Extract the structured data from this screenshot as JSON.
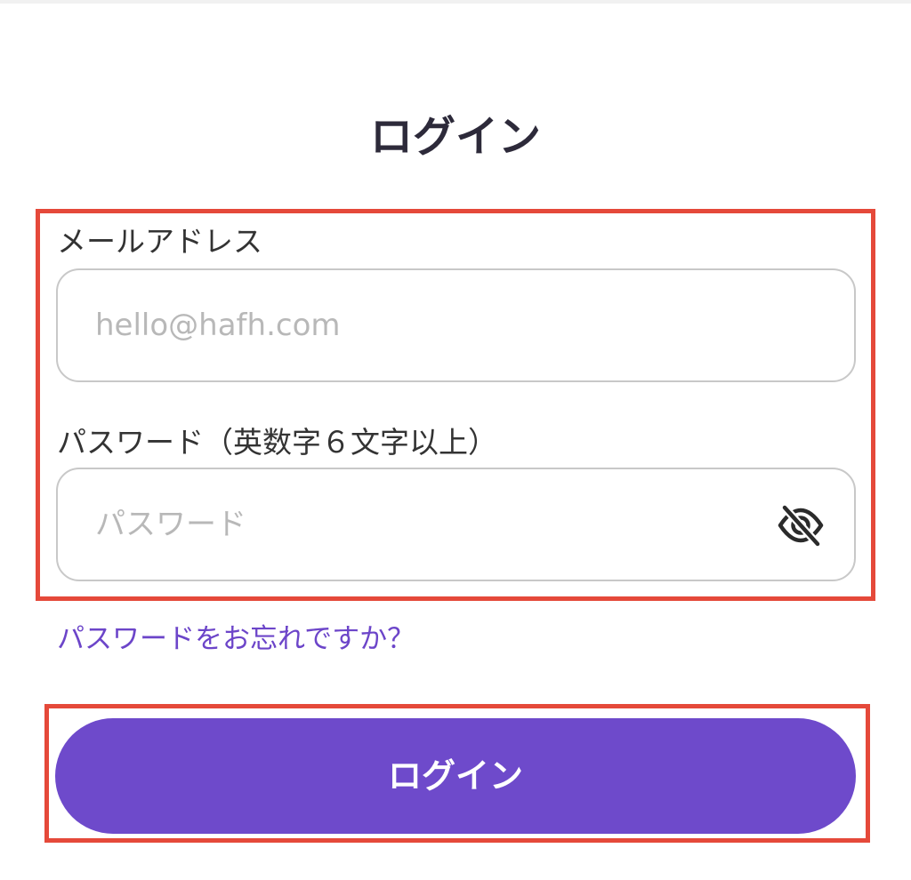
{
  "page": {
    "title": "ログイン"
  },
  "form": {
    "email": {
      "label": "メールアドレス",
      "placeholder": "hello@hafh.com",
      "value": ""
    },
    "password": {
      "label": "パスワード（英数字６文字以上）",
      "placeholder": "パスワード",
      "value": "",
      "visibility_icon": "eye-slash-icon"
    },
    "forgot_password_link": "パスワードをお忘れですか？",
    "submit_label": "ログイン"
  },
  "colors": {
    "accent": "#6e4acb",
    "link": "#6c45c9",
    "highlight": "#e5493a",
    "input_border": "#c8c8c8"
  }
}
